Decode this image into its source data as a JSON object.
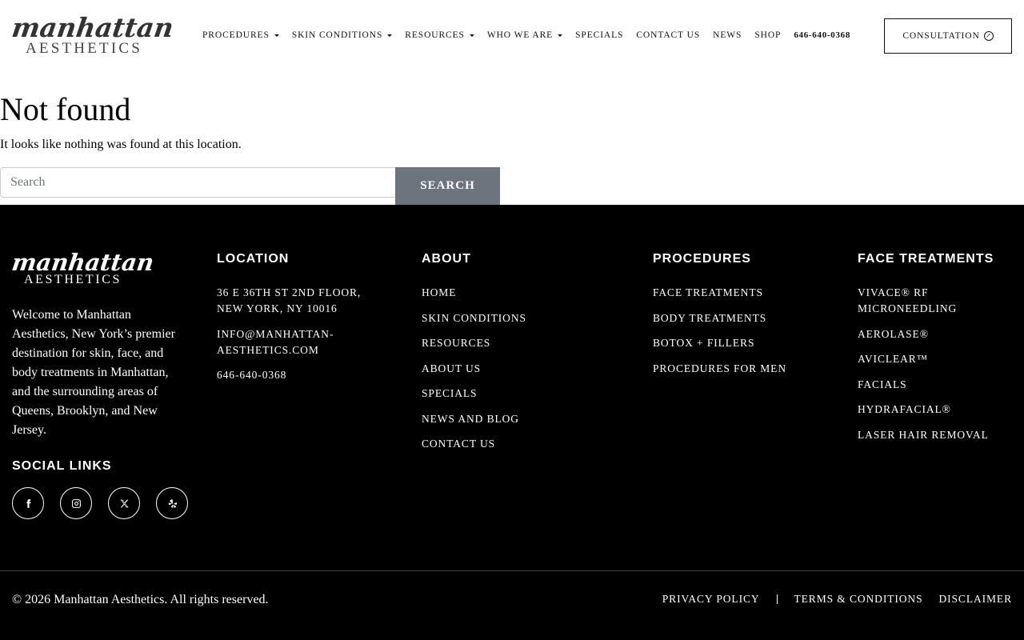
{
  "brand": {
    "logo_script": "manhattan",
    "logo_sub": "AESTHETICS"
  },
  "nav": {
    "items": [
      {
        "label": "PROCEDURES",
        "dropdown": true
      },
      {
        "label": "SKIN CONDITIONS",
        "dropdown": true
      },
      {
        "label": "RESOURCES",
        "dropdown": true
      },
      {
        "label": "WHO WE ARE",
        "dropdown": true
      },
      {
        "label": "SPECIALS",
        "dropdown": false
      },
      {
        "label": "CONTACT US",
        "dropdown": false
      },
      {
        "label": "NEWS",
        "dropdown": false
      },
      {
        "label": "SHOP",
        "dropdown": false
      }
    ],
    "phone": "646-640-0368",
    "consultation_label": "CONSULTATION"
  },
  "main": {
    "title": "Not found",
    "text": "It looks like nothing was found at this location.",
    "search_placeholder": "Search",
    "search_button": "SEARCH"
  },
  "footer": {
    "about_text": "Welcome to Manhattan Aesthetics, New York’s premier destination for skin, face, and body treatments in Manhattan, and the surrounding areas of Queens, Brooklyn, and New Jersey.",
    "social_title": "SOCIAL LINKS",
    "socials": [
      "facebook-icon",
      "instagram-icon",
      "x-icon",
      "yelp-icon"
    ],
    "location": {
      "title": "LOCATION",
      "address": "36 E 36TH ST 2ND FLOOR, NEW YORK, NY 10016",
      "email": "INFO@MANHATTAN-AESTHETICS.COM",
      "phone": "646-640-0368"
    },
    "about": {
      "title": "ABOUT",
      "items": [
        "HOME",
        "SKIN CONDITIONS",
        "RESOURCES",
        "ABOUT US",
        "SPECIALS",
        "NEWS AND BLOG",
        "CONTACT US"
      ]
    },
    "procedures": {
      "title": "PROCEDURES",
      "items": [
        "FACE TREATMENTS",
        "BODY TREATMENTS",
        "BOTOX + FILLERS",
        "PROCEDURES FOR MEN"
      ]
    },
    "face_treatments": {
      "title": "FACE TREATMENTS",
      "items": [
        "VIVACE® RF MICRONEEDLING",
        "AEROLASE®",
        "AVICLEAR™",
        "FACIALS",
        "HYDRAFACIAL®",
        "LASER HAIR REMOVAL"
      ]
    },
    "copyright": "© 2026 Manhattan Aesthetics. All rights reserved.",
    "legal": {
      "privacy": "PRIVACY POLICY",
      "terms": "TERMS & CONDITIONS",
      "disclaimer": "DISCLAIMER"
    }
  }
}
